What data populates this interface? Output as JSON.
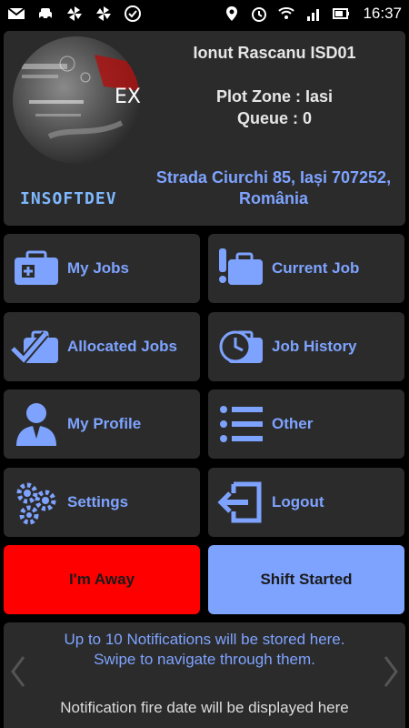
{
  "status_bar": {
    "time": "16:37",
    "left_icons": [
      "mail-icon",
      "car-icon",
      "pinwheel-icon",
      "pinwheel-icon",
      "check-circle-icon"
    ],
    "right_icons": [
      "location-icon",
      "alarm-icon",
      "wifi-icon",
      "signal-icon",
      "battery-icon"
    ]
  },
  "header": {
    "logo_overlay_text": "EX",
    "brand": "INSOFTDEV",
    "user_name": "Ionut Rascanu ISD01",
    "plot_zone": "Plot Zone : Iasi",
    "queue": "Queue : 0",
    "address": "Strada Ciurchi 85, Iași 707252, România"
  },
  "menu": {
    "my_jobs": "My Jobs",
    "current_job": "Current Job",
    "allocated_jobs": "Allocated Jobs",
    "job_history": "Job History",
    "my_profile": "My Profile",
    "other": "Other",
    "settings": "Settings",
    "logout": "Logout"
  },
  "actions": {
    "away": "I'm Away",
    "shift": "Shift Started"
  },
  "notifications": {
    "line1": "Up to 10 Notifications will be stored here.",
    "line2": "Swipe to navigate through them.",
    "date_placeholder": "Notification fire date will be displayed here"
  },
  "colors": {
    "accent": "#7ea3ff",
    "tile_bg": "#2b2b2b",
    "away": "#ff0000",
    "shift": "#7ea3ff"
  }
}
